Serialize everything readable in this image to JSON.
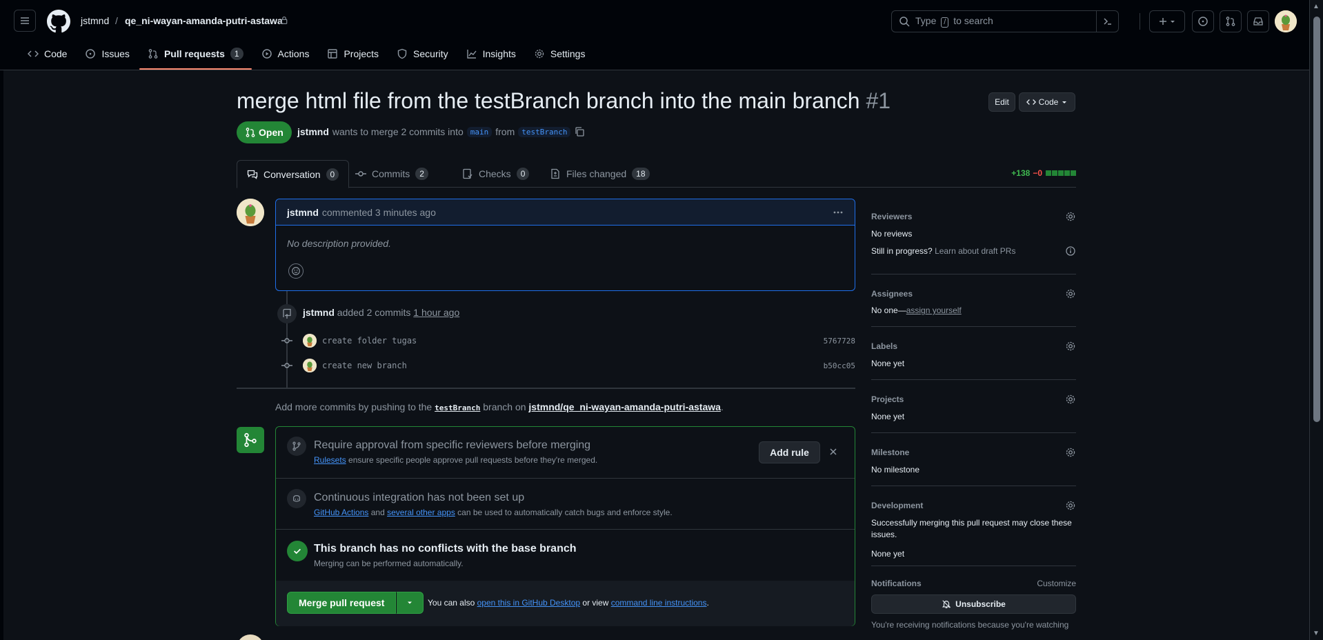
{
  "header": {
    "owner": "jstmnd",
    "separator": "/",
    "repo": "qe_ni-wayan-amanda-putri-astawa",
    "search_prefix": "Type",
    "search_key": "/",
    "search_suffix": "to search"
  },
  "repo_nav": {
    "items": [
      {
        "label": "Code",
        "icon": "code-icon"
      },
      {
        "label": "Issues",
        "icon": "issue-icon"
      },
      {
        "label": "Pull requests",
        "icon": "pull-request-icon",
        "count": "1"
      },
      {
        "label": "Actions",
        "icon": "play-icon"
      },
      {
        "label": "Projects",
        "icon": "table-icon"
      },
      {
        "label": "Security",
        "icon": "shield-icon"
      },
      {
        "label": "Insights",
        "icon": "graph-icon"
      },
      {
        "label": "Settings",
        "icon": "gear-icon"
      }
    ]
  },
  "pr": {
    "title": "merge html file from the testBranch branch into the main branch",
    "number": "#1",
    "edit_label": "Edit",
    "code_label": "Code",
    "state": "Open",
    "author": "jstmnd",
    "meta_text": "wants to merge 2 commits into",
    "base_branch": "main",
    "from_text": "from",
    "head_branch": "testBranch"
  },
  "tabs": [
    {
      "label": "Conversation",
      "count": "0"
    },
    {
      "label": "Commits",
      "count": "2"
    },
    {
      "label": "Checks",
      "count": "0"
    },
    {
      "label": "Files changed",
      "count": "18"
    }
  ],
  "diffstat": {
    "additions": "+138",
    "deletions": "−0"
  },
  "comment": {
    "author": "jstmnd",
    "action": "commented 3 minutes ago",
    "body": "No description provided."
  },
  "timeline": {
    "author": "jstmnd",
    "action": "added 2 commits",
    "time": "1 hour ago",
    "commits": [
      {
        "message": "create folder tugas",
        "sha": "5767728"
      },
      {
        "message": "create new branch",
        "sha": "b50cc05"
      }
    ]
  },
  "push_hint": {
    "prefix": "Add more commits by pushing to the",
    "branch": "testBranch",
    "middle": "branch on",
    "repo": "jstmnd/qe_ni-wayan-amanda-putri-astawa",
    "suffix": "."
  },
  "mergebox": {
    "approval_title": "Require approval from specific reviewers before merging",
    "approval_link": "Rulesets",
    "approval_text": "ensure specific people approve pull requests before they're merged.",
    "add_rule": "Add rule",
    "ci_title": "Continuous integration has not been set up",
    "ci_link1": "GitHub Actions",
    "ci_and": "and",
    "ci_link2": "several other apps",
    "ci_text": "can be used to automatically catch bugs and enforce style.",
    "conflict_title": "This branch has no conflicts with the base branch",
    "conflict_sub": "Merging can be performed automatically.",
    "merge_label": "Merge pull request",
    "alt_prefix": "You can also",
    "alt_link1": "open this in GitHub Desktop",
    "alt_middle": "or view",
    "alt_link2": "command line instructions",
    "alt_suffix": "."
  },
  "sidebar": {
    "reviewers": {
      "title": "Reviewers",
      "value": "No reviews",
      "draft_q": "Still in progress?",
      "draft_link": "Learn about draft PRs"
    },
    "assignees": {
      "title": "Assignees",
      "value": "No one—",
      "link": "assign yourself"
    },
    "labels": {
      "title": "Labels",
      "value": "None yet"
    },
    "projects": {
      "title": "Projects",
      "value": "None yet"
    },
    "milestone": {
      "title": "Milestone",
      "value": "No milestone"
    },
    "development": {
      "title": "Development",
      "text": "Successfully merging this pull request may close these issues.",
      "value": "None yet"
    },
    "notifications": {
      "title": "Notifications",
      "customize": "Customize",
      "unsubscribe": "Unsubscribe",
      "reason": "You're receiving notifications because you're watching"
    }
  },
  "colors": {
    "accent_green": "#238636",
    "link_blue": "#4493f8",
    "tab_underline": "#fd8c73"
  }
}
